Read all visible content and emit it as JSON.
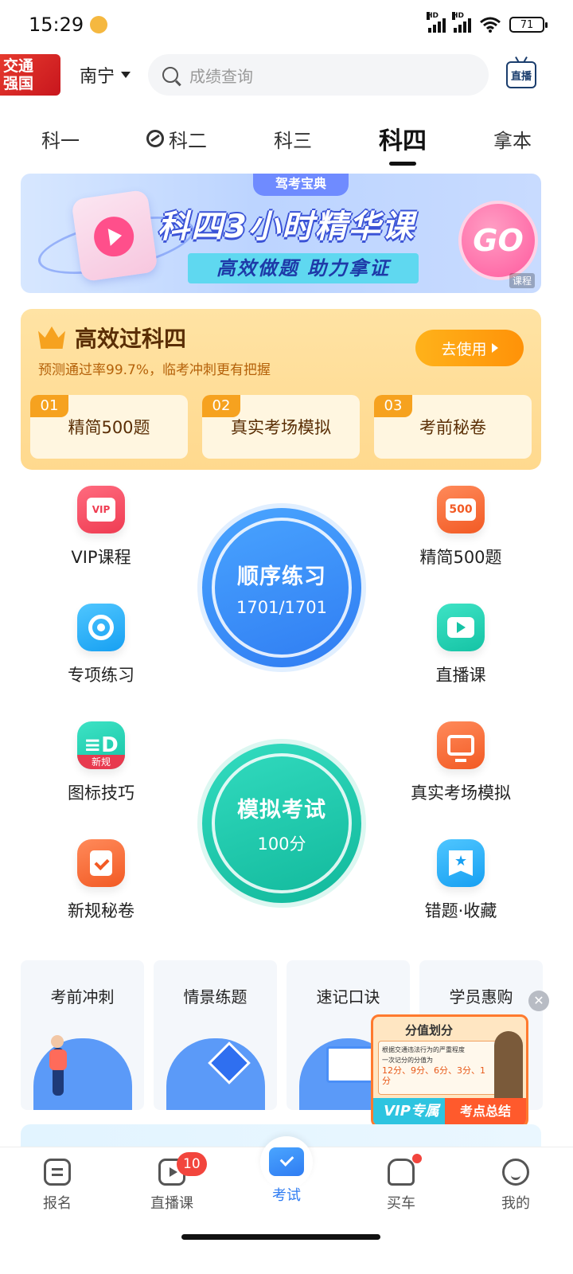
{
  "status_bar": {
    "time": "15:29",
    "battery": "71",
    "signal1": "HD",
    "signal2": "HD"
  },
  "header": {
    "logo_line1": "交通",
    "logo_line2": "强国",
    "city": "南宁",
    "search_placeholder": "成绩查询",
    "live_label": "直播"
  },
  "tabs": [
    {
      "label": "科一"
    },
    {
      "label": "科二"
    },
    {
      "label": "科三"
    },
    {
      "label": "科四"
    },
    {
      "label": "拿本"
    }
  ],
  "banner": {
    "tag": "驾考宝典",
    "title": "科四3小时精华课",
    "subtitle": "高效做题 助力拿证",
    "go": "GO",
    "label": "课程"
  },
  "promo": {
    "title": "高效过科四",
    "subtitle": "预测通过率99.7%，临考冲刺更有把握",
    "button": "去使用",
    "items": [
      {
        "num": "01",
        "label": "精简500题"
      },
      {
        "num": "02",
        "label": "真实考场模拟"
      },
      {
        "num": "03",
        "label": "考前秘卷"
      }
    ]
  },
  "features": {
    "vip_course": "VIP课程",
    "vip_badge": "VIP",
    "practice_500": "精简500题",
    "badge_500": "500",
    "special_practice": "专项练习",
    "live_course": "直播课",
    "sign_tips": "图标技巧",
    "sign_new": "新规",
    "real_exam_sim": "真实考场模拟",
    "new_rules_paper": "新规秘卷",
    "mistakes_favorites": "错题·收藏"
  },
  "big_buttons": {
    "sequential_title": "顺序练习",
    "sequential_progress": "1701/1701",
    "mock_title": "模拟考试",
    "mock_score": "100分"
  },
  "cards": [
    {
      "label": "考前冲刺"
    },
    {
      "label": "情景练题"
    },
    {
      "label": "速记口诀"
    },
    {
      "label": "学员惠购"
    }
  ],
  "float_video": {
    "title": "分值划分",
    "line1": "根据交通违法行为的严重程度",
    "line2": "一次记分的分值为",
    "values": "12分、9分、6分、3分、1分",
    "vip": "VIP专属",
    "tag": "考点总结",
    "close": "✕"
  },
  "bottom_nav": [
    {
      "label": "报名"
    },
    {
      "label": "直播课",
      "badge": "10"
    },
    {
      "label": "考试"
    },
    {
      "label": "买车"
    },
    {
      "label": "我的"
    }
  ],
  "colors": {
    "primary": "#2f7cf2",
    "teal": "#11b89b",
    "promo": "#ffd98e",
    "badge": "#f2453d"
  }
}
